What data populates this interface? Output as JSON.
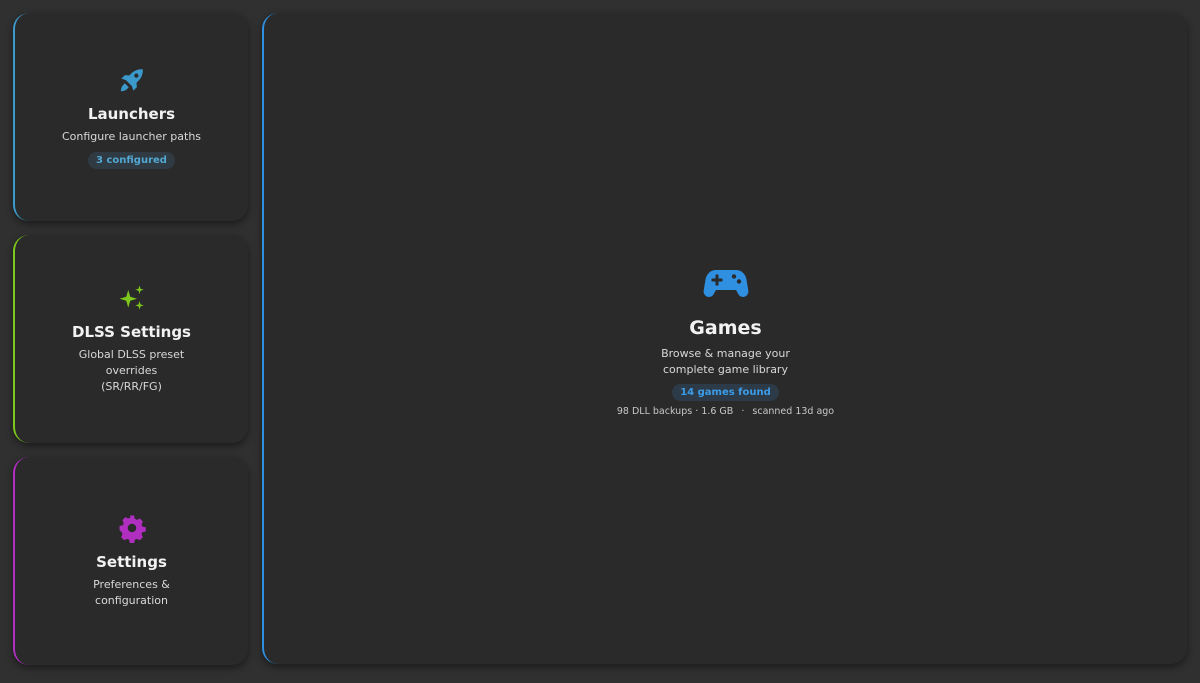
{
  "cards": {
    "launchers": {
      "title": "Launchers",
      "description": "Configure launcher paths",
      "badge": "3 configured",
      "icon": "rocket-icon",
      "accent": "#3b9acb"
    },
    "dlss": {
      "title": "DLSS Settings",
      "description": "Global DLSS preset overrides (SR/RR/FG)",
      "icon": "sparkles-icon",
      "accent": "#7ec81e"
    },
    "settings": {
      "title": "Settings",
      "description": "Preferences & configuration",
      "icon": "gear-icon",
      "accent": "#b02fc0"
    },
    "games": {
      "title": "Games",
      "description": "Browse & manage your complete game library",
      "badge": "14 games found",
      "meta": {
        "backups": "98 DLL backups",
        "size": "1.6 GB",
        "scanned": "scanned 13d ago"
      },
      "icon": "gamepad-icon",
      "accent": "#2f8fe0"
    }
  }
}
